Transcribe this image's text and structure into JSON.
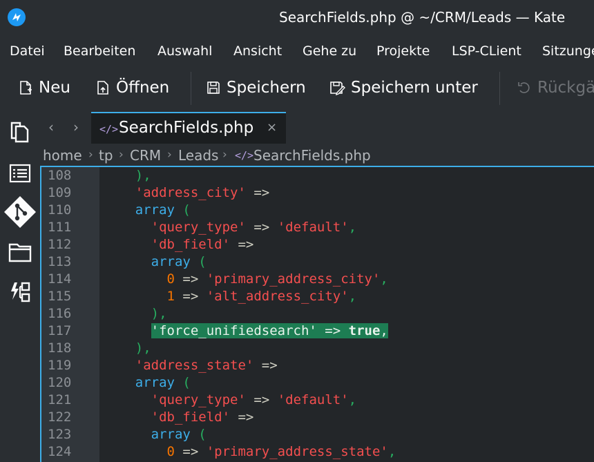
{
  "window": {
    "title": "SearchFields.php @ ~/CRM/Leads — Kate"
  },
  "menu": [
    "Datei",
    "Bearbeiten",
    "Auswahl",
    "Ansicht",
    "Gehe zu",
    "Projekte",
    "LSP-CLient",
    "Sitzungen"
  ],
  "toolbar": {
    "new_label": "Neu",
    "open_label": "Öffnen",
    "save_label": "Speichern",
    "save_as_label": "Speichern unter",
    "undo_label": "Rückgängig"
  },
  "sidebar": [
    "documents-icon",
    "symbols-list-icon",
    "git-icon",
    "folder-icon",
    "plugin-icon"
  ],
  "tab": {
    "label": "SearchFields.php",
    "close": "×",
    "nav_back": "‹",
    "nav_forward": "›",
    "icon": "</>"
  },
  "breadcrumb": [
    "home",
    "tp",
    "CRM",
    "Leads",
    "SearchFields.php"
  ],
  "code": {
    "highlighted_line": 117,
    "lines": [
      {
        "n": "108",
        "t": "    ),"
      },
      {
        "n": "109",
        "t": "    'address_city' =>"
      },
      {
        "n": "110",
        "t": "    array ("
      },
      {
        "n": "111",
        "t": "      'query_type' => 'default',"
      },
      {
        "n": "112",
        "t": "      'db_field' =>"
      },
      {
        "n": "113",
        "t": "      array ("
      },
      {
        "n": "114",
        "t": "        0 => 'primary_address_city',"
      },
      {
        "n": "115",
        "t": "        1 => 'alt_address_city',"
      },
      {
        "n": "116",
        "t": "      ),"
      },
      {
        "n": "117",
        "t": "      'force_unifiedsearch' => true,"
      },
      {
        "n": "118",
        "t": "    ),"
      },
      {
        "n": "119",
        "t": "    'address_state' =>"
      },
      {
        "n": "120",
        "t": "    array ("
      },
      {
        "n": "121",
        "t": "      'query_type' => 'default',"
      },
      {
        "n": "122",
        "t": "      'db_field' =>"
      },
      {
        "n": "123",
        "t": "      array ("
      },
      {
        "n": "124",
        "t": "        0 => 'primary_address_state',"
      }
    ]
  },
  "colors": {
    "accent": "#3daee9",
    "string": "#f44f4f",
    "keyword": "#3daee9",
    "number": "#f67400",
    "highlight": "#1d7d53"
  }
}
